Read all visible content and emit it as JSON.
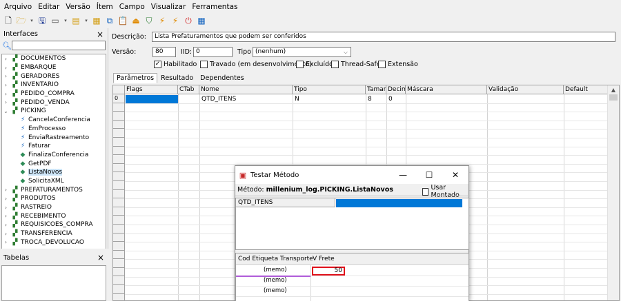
{
  "menu": [
    "Arquivo",
    "Editar",
    "Versão",
    "Ítem",
    "Campo",
    "Visualizar",
    "Ferramentas"
  ],
  "toolbar": {
    "icons": [
      "new-file-icon",
      "open-folder-icon",
      "save-icon",
      "screen-icon",
      "open-item-icon",
      "open-item2-icon",
      "copy-icon",
      "paste-icon",
      "upload-icon",
      "filter-icon",
      "test-icon",
      "test2-icon",
      "stop-icon",
      "calculator-icon"
    ]
  },
  "interfaces": {
    "title": "Interfaces",
    "close": "×",
    "search_placeholder": "",
    "tree": [
      {
        "label": "DOCUMENTOS",
        "expanded": false,
        "level": 0
      },
      {
        "label": "EMBARQUE",
        "expanded": false,
        "level": 0
      },
      {
        "label": "GERADORES",
        "expanded": false,
        "level": 0
      },
      {
        "label": "INVENTARIO",
        "expanded": false,
        "level": 0
      },
      {
        "label": "PEDIDO_COMPRA",
        "expanded": false,
        "level": 0
      },
      {
        "label": "PEDIDO_VENDA",
        "expanded": false,
        "level": 0
      },
      {
        "label": "PICKING",
        "expanded": true,
        "level": 0
      },
      {
        "label": "CancelaConferencia",
        "level": 1,
        "icon": "flash"
      },
      {
        "label": "EmProcesso",
        "level": 1,
        "icon": "flash"
      },
      {
        "label": "EnviaRastreamento",
        "level": 1,
        "icon": "flash"
      },
      {
        "label": "Faturar",
        "level": 1,
        "icon": "flash"
      },
      {
        "label": "FinalizaConferencia",
        "level": 1,
        "icon": "leaf"
      },
      {
        "label": "GetPDF",
        "level": 1,
        "icon": "leaf"
      },
      {
        "label": "ListaNovos",
        "level": 1,
        "icon": "leaf",
        "selected": true
      },
      {
        "label": "SolicitaXML",
        "level": 1,
        "icon": "leaf"
      },
      {
        "label": "PREFATURAMENTOS",
        "expanded": false,
        "level": 0
      },
      {
        "label": "PRODUTOS",
        "expanded": false,
        "level": 0
      },
      {
        "label": "RASTREIO",
        "expanded": false,
        "level": 0
      },
      {
        "label": "RECEBIMENTO",
        "expanded": false,
        "level": 0
      },
      {
        "label": "REQUISICOES_COMPRA",
        "expanded": false,
        "level": 0
      },
      {
        "label": "TRANSFERENCIA",
        "expanded": false,
        "level": 0
      },
      {
        "label": "TROCA_DEVOLUCAO",
        "expanded": false,
        "level": 0
      }
    ]
  },
  "tabelas": {
    "title": "Tabelas",
    "close": "×"
  },
  "form": {
    "descricao_label": "Descrição:",
    "descricao_value": "Lista Prefaturamentos que podem ser conferidos",
    "versao_label": "Versão:",
    "versao_value": "80",
    "iid_label": "IID:",
    "iid_value": "0",
    "tipo_label": "Tipo :",
    "tipo_value": "(nenhum)",
    "checks": [
      {
        "label": "Habilitado",
        "checked": true
      },
      {
        "label": "Travado (em desenvolvimento)",
        "checked": false
      },
      {
        "label": "Excluído",
        "checked": false
      },
      {
        "label": "Thread-Safe",
        "checked": false
      },
      {
        "label": "Extensão",
        "checked": false
      }
    ]
  },
  "tabs": [
    "Parâmetros",
    "Resultado",
    "Dependentes"
  ],
  "grid": {
    "columns": [
      "Flags",
      "CTab",
      "Nome",
      "Tipo",
      "Tamanh",
      "Decima",
      "Máscara",
      "Validação",
      "Default"
    ],
    "rows": [
      {
        "index": "0",
        "flags": "",
        "ctab": "",
        "nome": "QTD_ITENS",
        "tipo": "N",
        "tamanho": "8",
        "decimal": "0",
        "mascara": "",
        "validacao": "",
        "default": ""
      }
    ]
  },
  "dialog": {
    "title": "Testar Método",
    "minimize": "—",
    "maximize": "☐",
    "close": "✕",
    "metodo_label": "Método:",
    "metodo_value": "millenium_log.PICKING.ListaNovos",
    "usar_montado": "Usar Montado",
    "param_name": "QTD_ITENS",
    "result_columns": [
      "Cod Etiqueta Transporte",
      "V Frete"
    ],
    "result_rows": [
      {
        "cod": "(memo)",
        "frete": "50"
      },
      {
        "cod": "(memo)",
        "frete": ""
      },
      {
        "cod": "(memo)",
        "frete": ""
      }
    ]
  }
}
